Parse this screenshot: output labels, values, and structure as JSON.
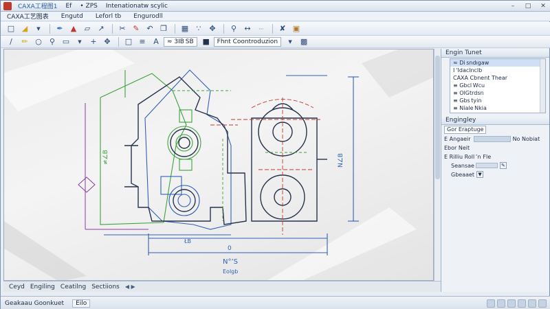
{
  "titlebar": {
    "app_title": "CAXA工艺图表",
    "tabs": [
      "CAXA工程图1",
      "Ef",
      "• ZPS",
      "Intenationatw scylic"
    ]
  },
  "menubar": {
    "items": [
      "CAXA工艺图表",
      "Engutd",
      "Leforl tb",
      "Engurodll"
    ]
  },
  "toolbar2": {
    "combo_scale": "≈ 3IB SB",
    "combo_label": "Fhnt Coontroduzion"
  },
  "drawing": {
    "dim_left_v": "≠∠B",
    "dim_right_v": "N∠B",
    "dim_bottom1": "ŁB",
    "dim_bottom2": "0",
    "dim_bottom3": "N°’S",
    "dim_bottom4": "Eolgb"
  },
  "layout_tabs": {
    "items": [
      "Ceyd",
      "Engiling",
      "Ceatilng",
      "Sectiions"
    ],
    "nav": "◀ ▶"
  },
  "right_panel": {
    "top_header": "Engin Tunet",
    "tree_items": [
      "≈ Di sndıgaw",
      "I ‘Idaclnclb",
      "CAXA Cbnent Thear",
      "≡ Gbcl Wcu",
      "≡ OlGtrdsn",
      "≡ Gbs tyin",
      "≡ Niale Nkia"
    ],
    "prop_header": "Engingley",
    "prop_combo": "Gor Eraptuge",
    "prop_rows": [
      {
        "label": "E Angaeir",
        "value": "No Nobiat"
      },
      {
        "label": "Ebor Neit",
        "value": ""
      },
      {
        "label": "E Rilliu Roll ’n",
        "value": "Fle"
      },
      {
        "label": "Seansae",
        "value": ""
      }
    ],
    "prop_footer": "Gbeaaet"
  },
  "statusbar": {
    "text": "Geakaau Goonkuet",
    "box": "Eilo"
  },
  "colors": {
    "accent": "#2b5fa3",
    "drawing_blue": "#2f5fb8",
    "drawing_green": "#3aa23a",
    "drawing_red": "#c0392b",
    "drawing_purple": "#8a3aa0"
  }
}
